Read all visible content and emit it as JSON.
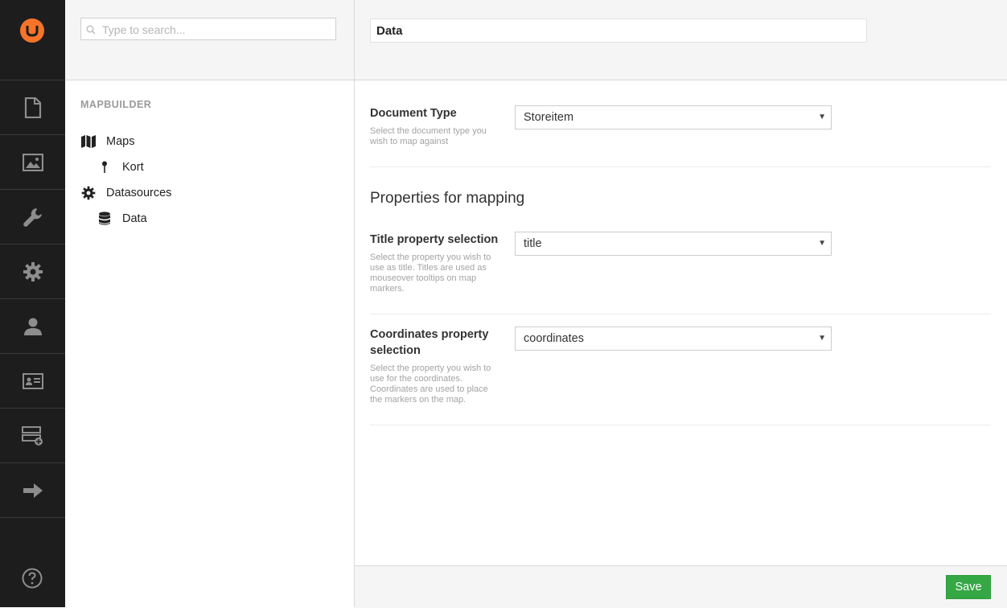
{
  "search": {
    "placeholder": "Type to search..."
  },
  "tree": {
    "section_title": "MAPBUILDER",
    "items": [
      {
        "label": "Maps",
        "icon": "map-icon"
      },
      {
        "label": "Kort",
        "icon": "pin-icon"
      },
      {
        "label": "Datasources",
        "icon": "gear-icon"
      },
      {
        "label": "Data",
        "icon": "database-icon"
      }
    ]
  },
  "editor": {
    "name_value": "Data",
    "document_type": {
      "label": "Document Type",
      "description": "Select the document type you wish to map against",
      "selected": "Storeitem"
    },
    "group_title": "Properties for mapping",
    "title_property": {
      "label": "Title property selection",
      "description": "Select the property you wish to use as title. Titles are used as mouseover tooltips on map markers.",
      "selected": "title"
    },
    "coordinates_property": {
      "label": "Coordinates property selection",
      "description": "Select the property you wish to use for the coordinates. Coordinates are used to place the markers on the map.",
      "selected": "coordinates"
    }
  },
  "footer": {
    "save_label": "Save"
  },
  "colors": {
    "brand": "#f5742a",
    "appbar": "#1d1d1d",
    "save": "#35a745"
  },
  "appbar_icons": [
    "content-icon",
    "media-icon",
    "settings-wrench-icon",
    "developer-gear-icon",
    "users-icon",
    "members-icon",
    "forms-icon",
    "redirect-arrow-icon",
    "help-icon"
  ]
}
